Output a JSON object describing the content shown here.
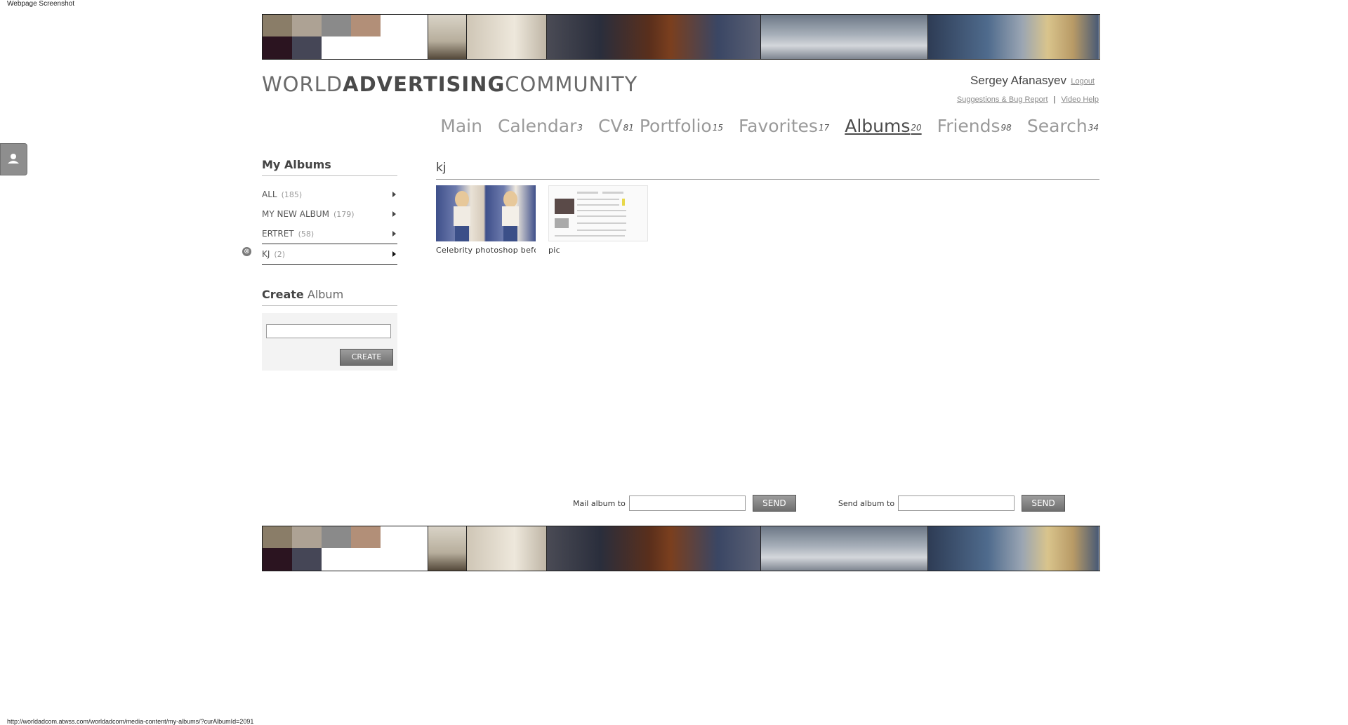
{
  "window": {
    "caption": "Webpage Screenshot",
    "status_url": "http://worldadcom.atwss.com/worldadcom/media-content/my-albums/?curAlbumId=2091"
  },
  "colors": {
    "swatches": [
      "#8a7d68",
      "#ada294",
      "#8a8a8a",
      "#b28f78",
      "#2b1420",
      "#454656"
    ]
  },
  "header": {
    "logo_part1": "WORLD",
    "logo_part2": "ADVERTISING",
    "logo_part3": "COMMUNITY",
    "user_name": "Sergey Afanasyev",
    "logout_label": "Logout",
    "suggestions_label": "Suggestions & Bug Report",
    "separator": "|",
    "video_help_label": "Video Help"
  },
  "nav": [
    {
      "label": "Main",
      "count": ""
    },
    {
      "label": "Calendar",
      "count": "3"
    },
    {
      "label": "CV",
      "count": "81"
    },
    {
      "label": "Portfolio",
      "count": "15"
    },
    {
      "label": "Favorites",
      "count": "17"
    },
    {
      "label": "Albums",
      "count": "20"
    },
    {
      "label": "Friends",
      "count": "98"
    },
    {
      "label": "Search",
      "count": "34"
    }
  ],
  "sidebar": {
    "title": "My Albums",
    "albums": [
      {
        "name": "ALL",
        "count": "(185)"
      },
      {
        "name": "MY NEW ALBUM",
        "count": "(179)"
      },
      {
        "name": "ERTRET",
        "count": "(58)"
      },
      {
        "name": "KJ",
        "count": "(2)"
      }
    ],
    "create_title_bold": "Create",
    "create_title_light": "Album",
    "create_input_value": "",
    "create_button_label": "CREATE"
  },
  "content": {
    "album_title": "kj",
    "items": [
      {
        "caption": "Celebrity photoshop before and after"
      },
      {
        "caption": "pic"
      }
    ]
  },
  "mail": {
    "mail_label": "Mail album to",
    "mail_value": "",
    "send_button_label": "SEND",
    "send_label": "Send album to",
    "send_value": "",
    "send_button2_label": "SEND"
  },
  "icons": {
    "remove": "⊗",
    "side_tab": "user-icon"
  }
}
